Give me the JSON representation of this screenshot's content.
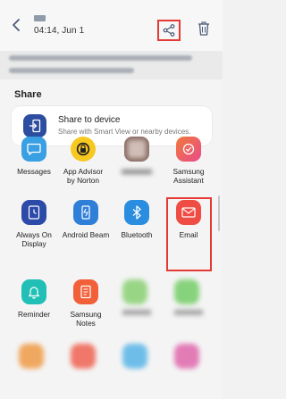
{
  "header": {
    "time_text": "04:14, Jun 1"
  },
  "share_sheet": {
    "title": "Share",
    "device": {
      "title": "Share to device",
      "subtitle": "Share with Smart View or nearby devices."
    },
    "apps": [
      {
        "label": "Messages",
        "icon": "messages-icon",
        "color": "#3aa0e3"
      },
      {
        "label": "App Advisor\nby Norton",
        "icon": "norton-lock-icon",
        "color": "#f7c820"
      },
      {
        "label": "",
        "icon": "blurred-app-icon",
        "color": "#8a6f66"
      },
      {
        "label": "Samsung\nAssistant",
        "icon": "samsung-assistant-icon",
        "color": "#ea4a8b"
      },
      {
        "label": "Always On\nDisplay",
        "icon": "clock-icon",
        "color": "#2c4aa8"
      },
      {
        "label": "Android Beam",
        "icon": "android-beam-icon",
        "color": "#2f7fd8"
      },
      {
        "label": "Bluetooth",
        "icon": "bluetooth-icon",
        "color": "#2a8ddf"
      },
      {
        "label": "Email",
        "icon": "email-icon",
        "color": "#ef4d43"
      },
      {
        "label": "Reminder",
        "icon": "bell-icon",
        "color": "#21bfb5"
      },
      {
        "label": "Samsung\nNotes",
        "icon": "notes-icon",
        "color": "#f2603a"
      }
    ]
  },
  "colors": {
    "highlight": "#e53935",
    "device_icon_bg": "#2d4da0"
  }
}
